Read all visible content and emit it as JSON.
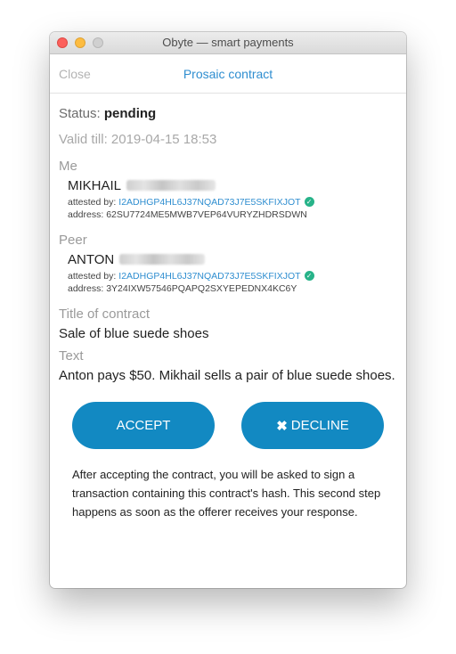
{
  "window": {
    "title": "Obyte — smart payments"
  },
  "nav": {
    "close_label": "Close",
    "title": "Prosaic contract"
  },
  "contract": {
    "status_label": "Status:",
    "status_value": "pending",
    "valid_till": "Valid till: 2019-04-15 18:53",
    "me": {
      "section_label": "Me",
      "name": "MIKHAIL",
      "attested_label": "attested by:",
      "attested_by": "I2ADHGP4HL6J37NQAD73J7E5SKFIXJOT",
      "address": "address: 62SU7724ME5MWB7VEP64VURYZHDRSDWN"
    },
    "peer": {
      "section_label": "Peer",
      "name": "ANTON",
      "attested_label": "attested by:",
      "attested_by": "I2ADHGP4HL6J37NQAD73J7E5SKFIXJOT",
      "address": "address: 3Y24IXW57546PQAPQ2SXYEPEDNX4KC6Y"
    },
    "title_label": "Title of contract",
    "title_value": "Sale of blue suede shoes",
    "text_label": "Text",
    "text_value": "Anton pays $50. Mikhail sells a pair of blue suede shoes."
  },
  "actions": {
    "accept_label": "ACCEPT",
    "decline_label": "DECLINE"
  },
  "note": "After accepting the contract, you will be asked to sign a transaction containing this contract's hash. This second step happens as soon as the offerer receives your response.",
  "colors": {
    "accent": "#2f8ed0",
    "button": "#1289c2",
    "verified": "#27b389"
  },
  "icons": {
    "verified": "check-circle-icon",
    "decline": "x-icon"
  }
}
